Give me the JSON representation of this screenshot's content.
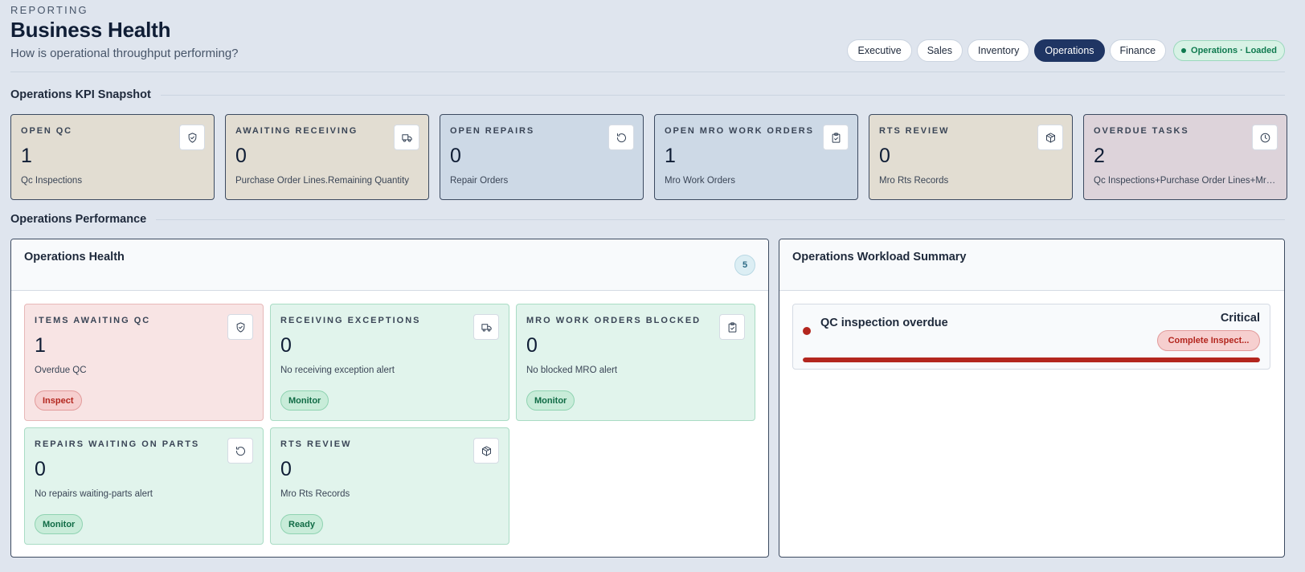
{
  "header": {
    "eyebrow": "REPORTING",
    "title": "Business Health",
    "subtitle": "How is operational throughput performing?"
  },
  "tabs": [
    {
      "label": "Executive",
      "active": false
    },
    {
      "label": "Sales",
      "active": false
    },
    {
      "label": "Inventory",
      "active": false
    },
    {
      "label": "Operations",
      "active": true
    },
    {
      "label": "Finance",
      "active": false
    }
  ],
  "status": {
    "label": "Operations · Loaded",
    "color": "#0f7a4f"
  },
  "kpi_section": {
    "title": "Operations KPI Snapshot"
  },
  "kpis": [
    {
      "label": "OPEN QC",
      "value": "1",
      "caption": "Qc Inspections",
      "icon": "shield-check-icon",
      "tone": "beige"
    },
    {
      "label": "AWAITING RECEIVING",
      "value": "0",
      "caption": "Purchase Order Lines.Remaining Quantity",
      "icon": "truck-icon",
      "tone": "beige"
    },
    {
      "label": "OPEN REPAIRS",
      "value": "0",
      "caption": "Repair Orders",
      "icon": "rotate-icon",
      "tone": "blue"
    },
    {
      "label": "OPEN MRO WORK ORDERS",
      "value": "1",
      "caption": "Mro Work Orders",
      "icon": "clipboard-icon",
      "tone": "blue"
    },
    {
      "label": "RTS REVIEW",
      "value": "0",
      "caption": "Mro Rts Records",
      "icon": "package-icon",
      "tone": "beige"
    },
    {
      "label": "OVERDUE TASKS",
      "value": "2",
      "caption": "Qc Inspections+Purchase Order Lines+Mro Work Orders",
      "icon": "clock-icon",
      "tone": "mauve"
    }
  ],
  "performance_section": {
    "title": "Operations Performance"
  },
  "health_panel": {
    "title": "Operations Health",
    "count": "5",
    "cards": [
      {
        "label": "ITEMS AWAITING QC",
        "value": "1",
        "caption": "Overdue QC",
        "pill": "Inspect",
        "state": "danger",
        "icon": "shield-check-icon"
      },
      {
        "label": "RECEIVING EXCEPTIONS",
        "value": "0",
        "caption": "No receiving exception alert",
        "pill": "Monitor",
        "state": "ok",
        "icon": "truck-icon"
      },
      {
        "label": "MRO WORK ORDERS BLOCKED",
        "value": "0",
        "caption": "No blocked MRO alert",
        "pill": "Monitor",
        "state": "ok",
        "icon": "clipboard-icon"
      },
      {
        "label": "REPAIRS WAITING ON PARTS",
        "value": "0",
        "caption": "No repairs waiting-parts alert",
        "pill": "Monitor",
        "state": "ok",
        "icon": "rotate-icon"
      },
      {
        "label": "RTS REVIEW",
        "value": "0",
        "caption": "Mro Rts Records",
        "pill": "Ready",
        "state": "ok",
        "icon": "package-icon"
      }
    ]
  },
  "workload_panel": {
    "title": "Operations Workload Summary",
    "items": [
      {
        "title": "QC inspection overdue",
        "severity": "Critical",
        "action": "Complete Inspect...",
        "progress": 1.0,
        "color": "#b3261e"
      }
    ]
  }
}
